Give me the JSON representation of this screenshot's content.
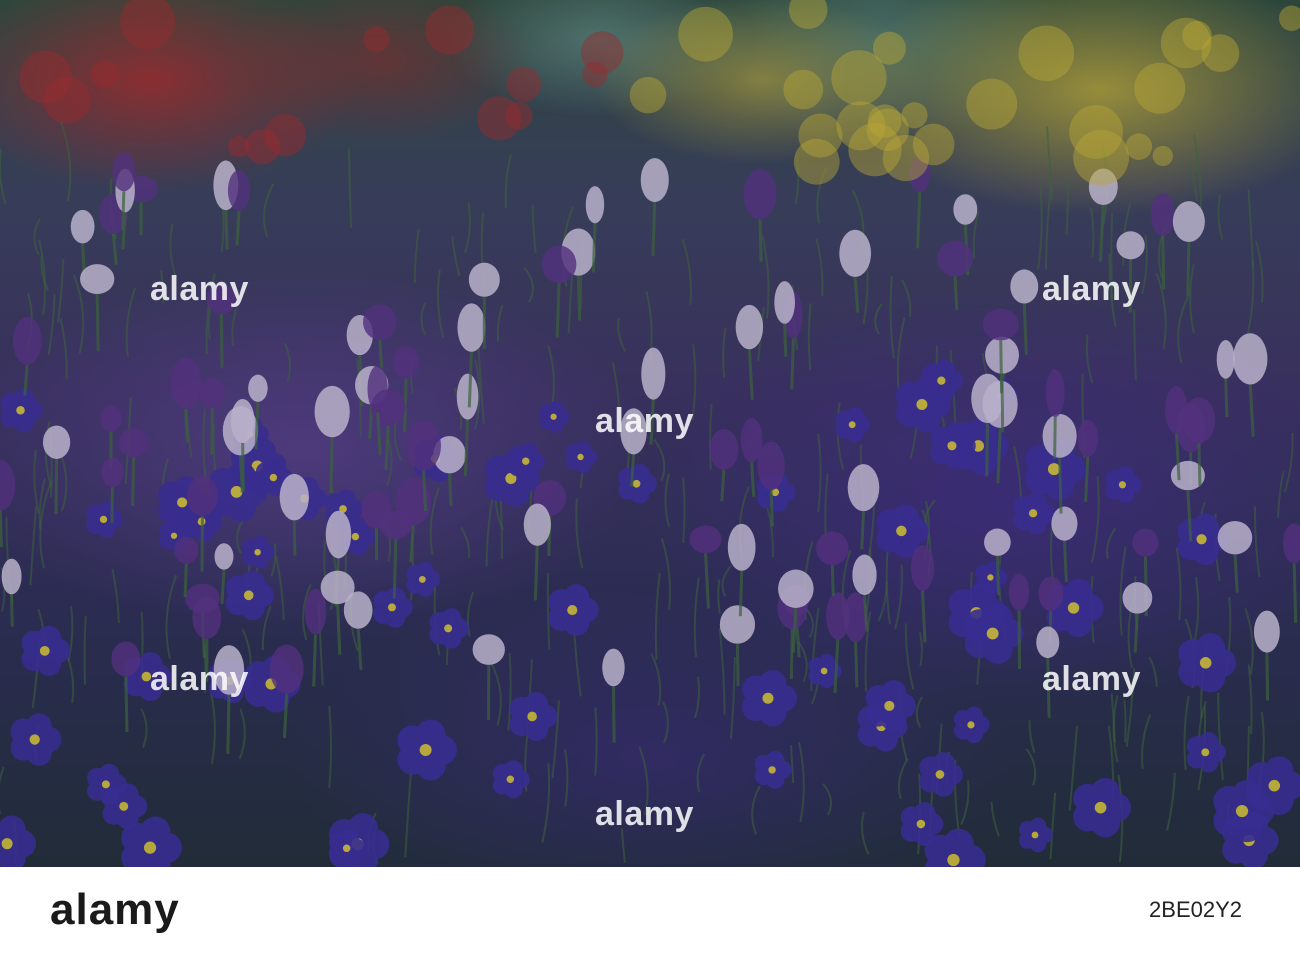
{
  "photo": {
    "subject": "Flower bed with purple and pale lilac crocuses, purple primroses with yellow centers, red and yellow flowers blurred in the background",
    "colors": {
      "crocus_pale": "#d8cde6",
      "crocus_purple": "#5b2f8a",
      "primrose_violet": "#3b2ba0",
      "primrose_center": "#e8d23a",
      "foliage": "#3f6b3a",
      "background_red": "#b22828",
      "background_yellow": "#d7be32"
    },
    "watermarks": [
      "alamy",
      "alamy",
      "alamy",
      "alamy",
      "alamy",
      "alamy"
    ]
  },
  "footer": {
    "logo": "alamy",
    "image_id": "2BE02Y2"
  }
}
